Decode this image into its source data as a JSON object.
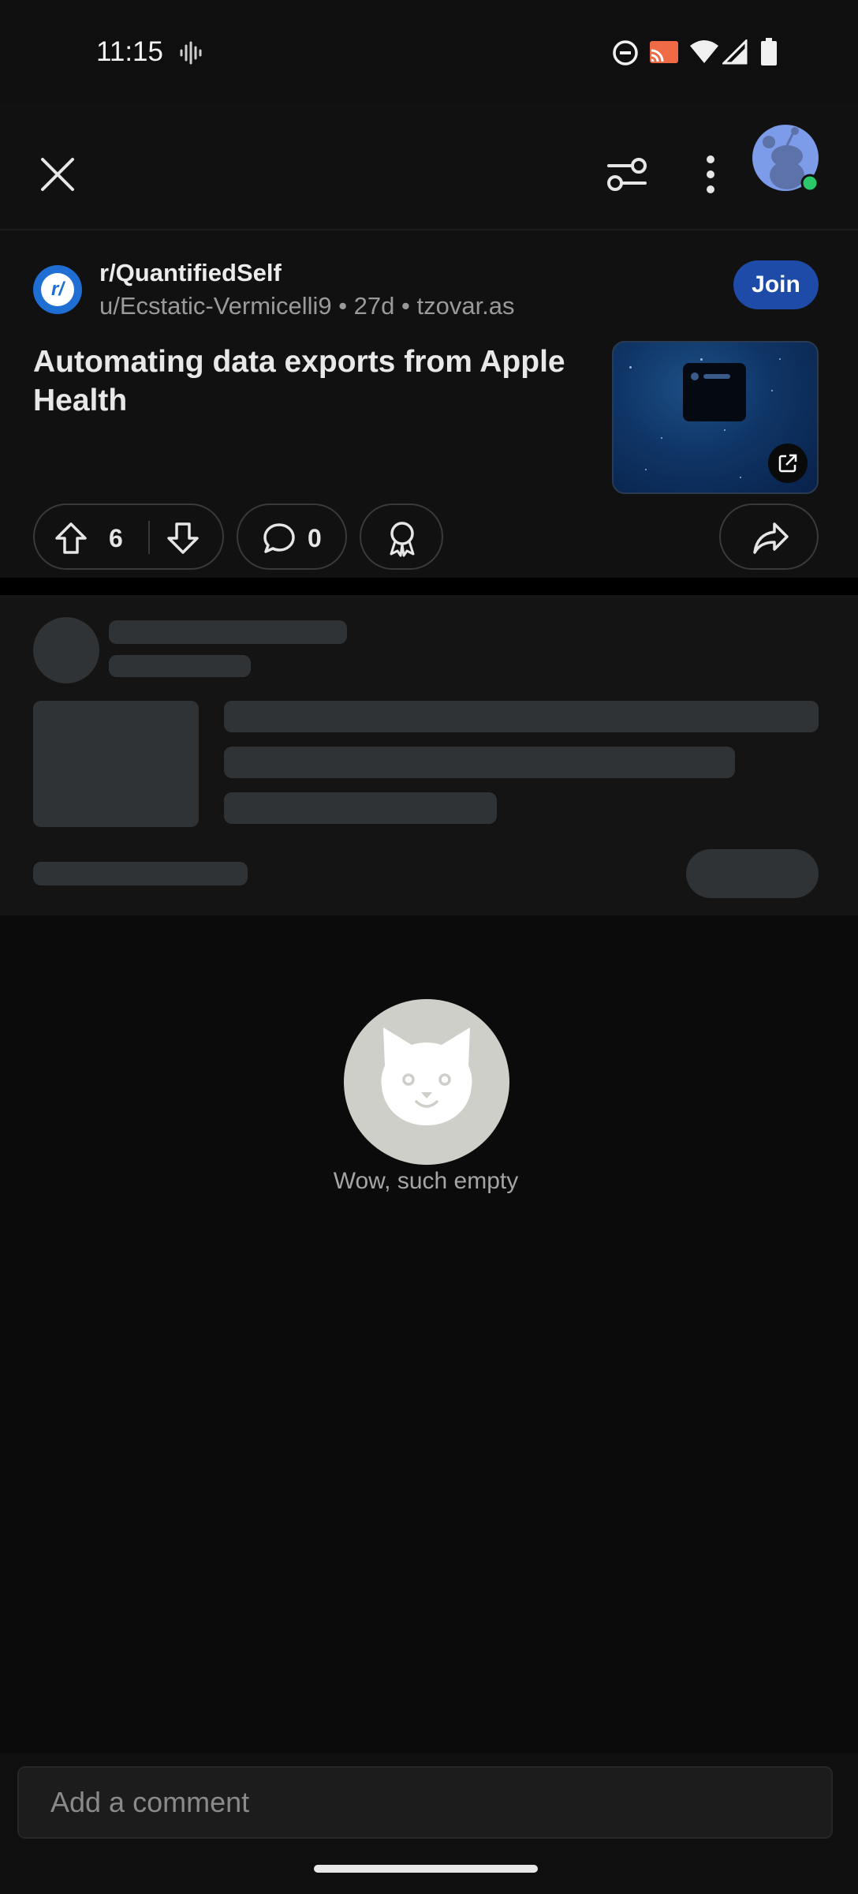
{
  "status_bar": {
    "time": "11:15"
  },
  "toolbar": {
    "close": "close",
    "filter": "filter",
    "more": "more options",
    "avatar": "user avatar"
  },
  "post": {
    "subreddit": "r/QuantifiedSelf",
    "subreddit_icon_text": "r/",
    "meta": "u/Ecstatic-Vermicelli9 • 27d • tzovar.as",
    "join_label": "Join",
    "title": "Automating data exports from Apple Health",
    "upvotes": "6",
    "comments": "0"
  },
  "empty_state": {
    "text": "Wow, such empty"
  },
  "comment_input": {
    "placeholder": "Add a comment"
  },
  "colors": {
    "background": "#0b0b0b",
    "join_button": "#1e4aa8",
    "online_dot": "#2bc86a",
    "avatar": "#7c9be8"
  }
}
